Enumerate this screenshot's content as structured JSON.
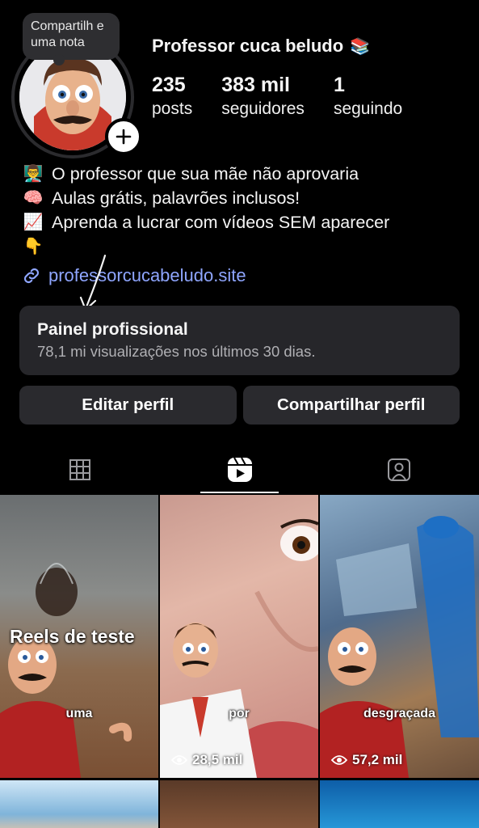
{
  "profile": {
    "note": "Compartilh e uma nota",
    "username": "Professor cuca beludo",
    "username_emoji": "📚",
    "stats": [
      {
        "value": "235",
        "label": "posts"
      },
      {
        "value": "383 mil",
        "label": "seguidores"
      },
      {
        "value": "1",
        "label": "seguindo"
      }
    ]
  },
  "bio": [
    {
      "emoji": "👨‍🏫",
      "text": "O professor que sua mãe não aprovaria"
    },
    {
      "emoji": "🧠",
      "text": "Aulas grátis, palavrões inclusos!"
    },
    {
      "emoji": "📈",
      "text": "Aprenda a lucrar com vídeos SEM aparecer"
    },
    {
      "emoji": "👇",
      "text": ""
    }
  ],
  "link": {
    "text": "professorcucabeludo.site",
    "icon": "link-icon"
  },
  "panel": {
    "title": "Painel profissional",
    "subtitle": "78,1 mi visualizações nos últimos 30 dias."
  },
  "actions": {
    "edit": "Editar perfil",
    "share": "Compartilhar perfil"
  },
  "tabs": [
    {
      "name": "grid-icon",
      "active": false
    },
    {
      "name": "reels-icon",
      "active": true
    },
    {
      "name": "tagged-icon",
      "active": false
    }
  ],
  "reels": [
    {
      "overlay_title": "Reels de teste",
      "caption": "uma",
      "views": ""
    },
    {
      "overlay_title": "",
      "caption": "por",
      "views": "28,5 mil"
    },
    {
      "overlay_title": "",
      "caption": "desgraçada",
      "views": "57,2 mil"
    }
  ],
  "colors": {
    "link": "#8fa6ff",
    "panel_bg": "#26262a",
    "button_bg": "#2a2a2e",
    "background": "#000000"
  }
}
